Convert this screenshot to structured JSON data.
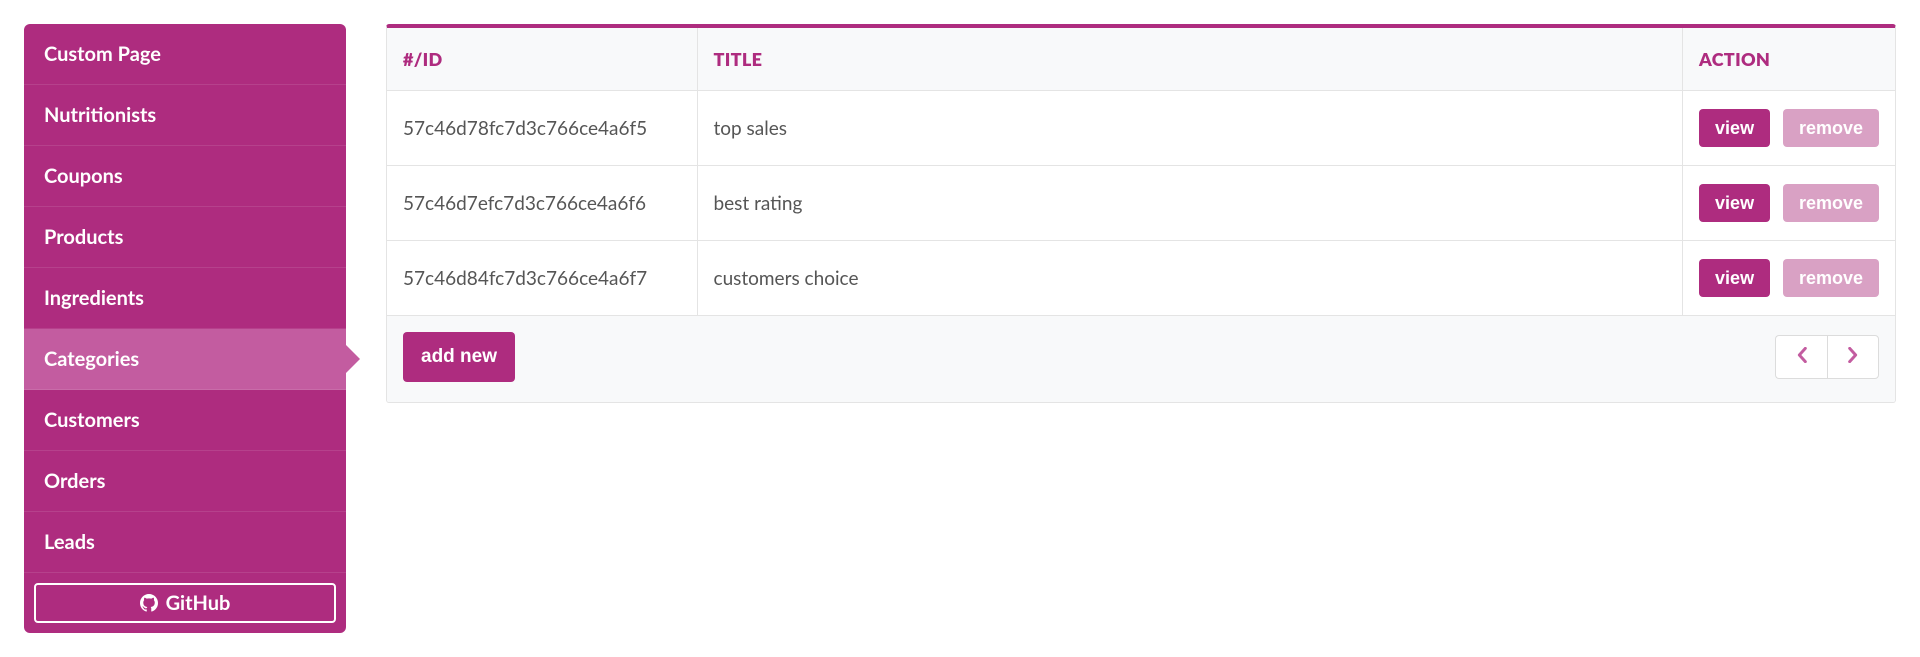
{
  "sidebar": {
    "items": [
      {
        "label": "Custom Page",
        "active": false
      },
      {
        "label": "Nutritionists",
        "active": false
      },
      {
        "label": "Coupons",
        "active": false
      },
      {
        "label": "Products",
        "active": false
      },
      {
        "label": "Ingredients",
        "active": false
      },
      {
        "label": "Categories",
        "active": true
      },
      {
        "label": "Customers",
        "active": false
      },
      {
        "label": "Orders",
        "active": false
      },
      {
        "label": "Leads",
        "active": false
      }
    ],
    "github_label": "GitHub"
  },
  "table": {
    "headers": {
      "id": "#/ID",
      "title": "TITLE",
      "action": "ACTION"
    },
    "rows": [
      {
        "id": "57c46d78fc7d3c766ce4a6f5",
        "title": "top sales",
        "view": "view",
        "remove": "remove"
      },
      {
        "id": "57c46d7efc7d3c766ce4a6f6",
        "title": "best rating",
        "view": "view",
        "remove": "remove"
      },
      {
        "id": "57c46d84fc7d3c766ce4a6f7",
        "title": "customers choice",
        "view": "view",
        "remove": "remove"
      }
    ]
  },
  "footer": {
    "add_label": "add new"
  },
  "colors": {
    "brand": "#ae2c7f",
    "brand_light": "#c35ca0",
    "remove_btn": "#d9a1c4"
  }
}
